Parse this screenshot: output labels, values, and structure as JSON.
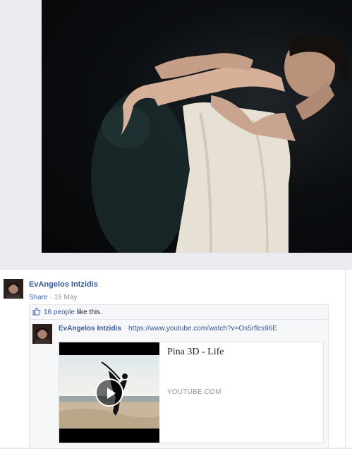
{
  "post": {
    "author_name": "EvAngelos Intzidis",
    "share_label": "Share",
    "separator": " · ",
    "date": "15 May"
  },
  "likes": {
    "count_text": "16 people",
    "suffix": " like this."
  },
  "comment": {
    "author_name": "EvAngelos Intzidis",
    "link_text": "https://www.youtube.com/watch?v=Os5rflcs96E"
  },
  "attachment": {
    "title": "Pina 3D - Life",
    "domain": "YOUTUBE.COM"
  },
  "icons": {
    "like": "thumbs-up-icon",
    "play": "play-icon"
  },
  "colors": {
    "link_blue": "#365899",
    "meta_gray": "#90949c",
    "page_bg": "#e9ebee"
  }
}
